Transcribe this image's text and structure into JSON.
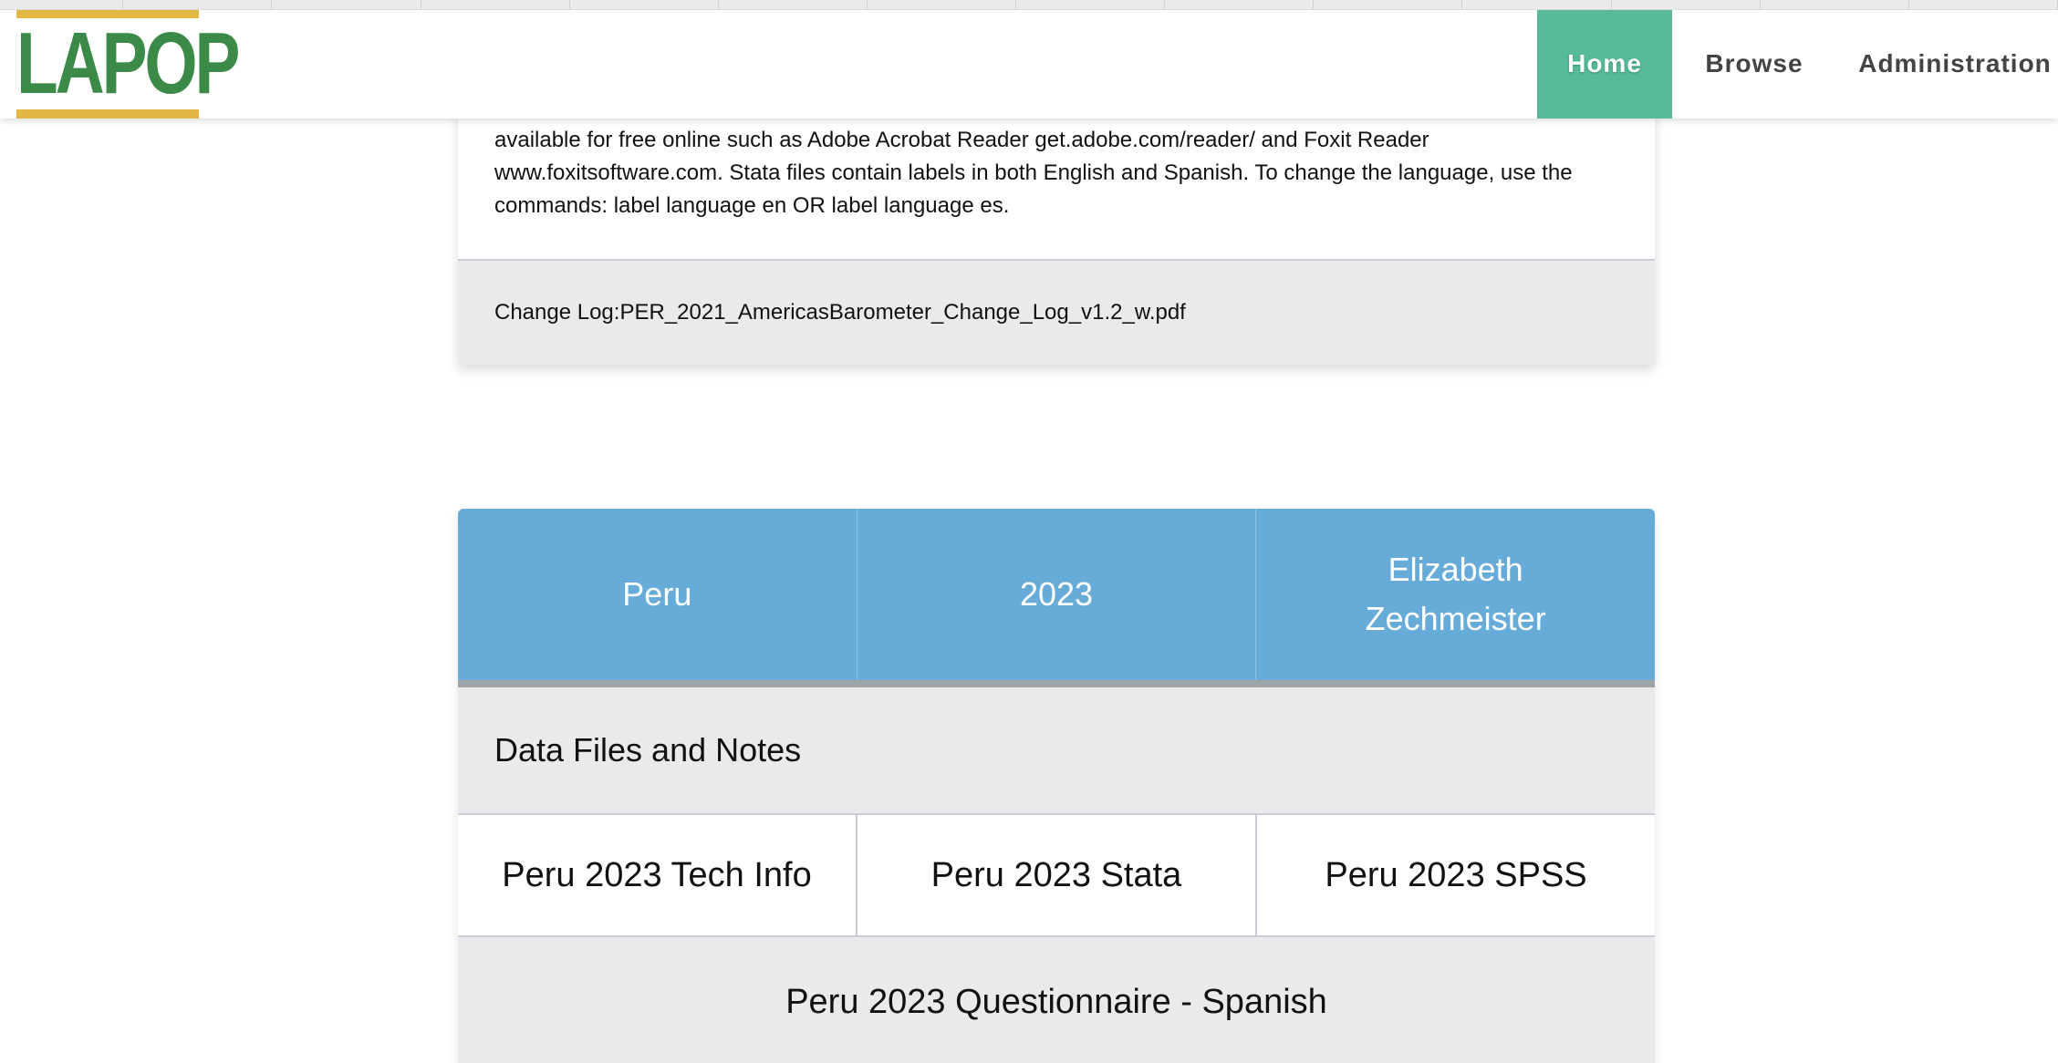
{
  "header": {
    "logo_text": "LAPOP",
    "nav": [
      {
        "label": "Home",
        "active": true
      },
      {
        "label": "Browse",
        "active": false
      },
      {
        "label": "Administration",
        "active": false
      }
    ]
  },
  "previous_entry": {
    "notes_lines": [
      "available for free online such as Adobe Acrobat Reader get.adobe.com/reader/ and Foxit Reader",
      "www.foxitsoftware.com. Stata files contain labels in both English and Spanish. To change the language, use the",
      "commands: label language en OR label language es."
    ],
    "change_log": "Change Log:PER_2021_AmericasBarometer_Change_Log_v1.2_w.pdf"
  },
  "entry": {
    "country": "Peru",
    "year": "2023",
    "author": "Elizabeth Zechmeister",
    "section_title": "Data Files and Notes",
    "files": [
      "Peru 2023 Tech Info",
      "Peru 2023 Stata",
      "Peru 2023 SPSS"
    ],
    "questionnaire": "Peru 2023 Questionnaire - Spanish"
  },
  "colors": {
    "logo_green": "#3b8a47",
    "logo_gold": "#e3b743",
    "nav_active": "#55b99a",
    "info_blue": "#67abd8",
    "panel_gray": "#eaeaea"
  }
}
